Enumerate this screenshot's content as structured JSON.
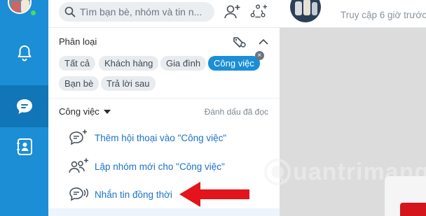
{
  "search": {
    "placeholder": "Tìm bạn bè, nhóm và tin n..."
  },
  "category": {
    "header": "Phân loại",
    "chips": [
      {
        "label": "Tất cả",
        "selected": false
      },
      {
        "label": "Khách hàng",
        "selected": false
      },
      {
        "label": "Gia đình",
        "selected": false
      },
      {
        "label": "Công việc",
        "selected": true
      },
      {
        "label": "Bạn bè",
        "selected": false
      },
      {
        "label": "Trả lời sau",
        "selected": false
      }
    ]
  },
  "section": {
    "title": "Công việc",
    "mark_read": "Đánh dấu đã đọc",
    "actions": [
      {
        "label": "Thêm hội thoại vào \"Công việc\"",
        "icon": "message-plus-icon"
      },
      {
        "label": "Lập nhóm mới cho \"Công việc\"",
        "icon": "group-add-icon"
      },
      {
        "label": "Nhắn tin đồng thời",
        "icon": "broadcast-message-icon"
      }
    ]
  },
  "chat": {
    "status": "Truy cập 6 giờ trước"
  },
  "watermark": {
    "text": "uantrimang"
  },
  "colors": {
    "accent": "#1b8ed6",
    "rail": "#1b8ed6",
    "arrow": "#e3141b",
    "link": "#1a73c8"
  }
}
